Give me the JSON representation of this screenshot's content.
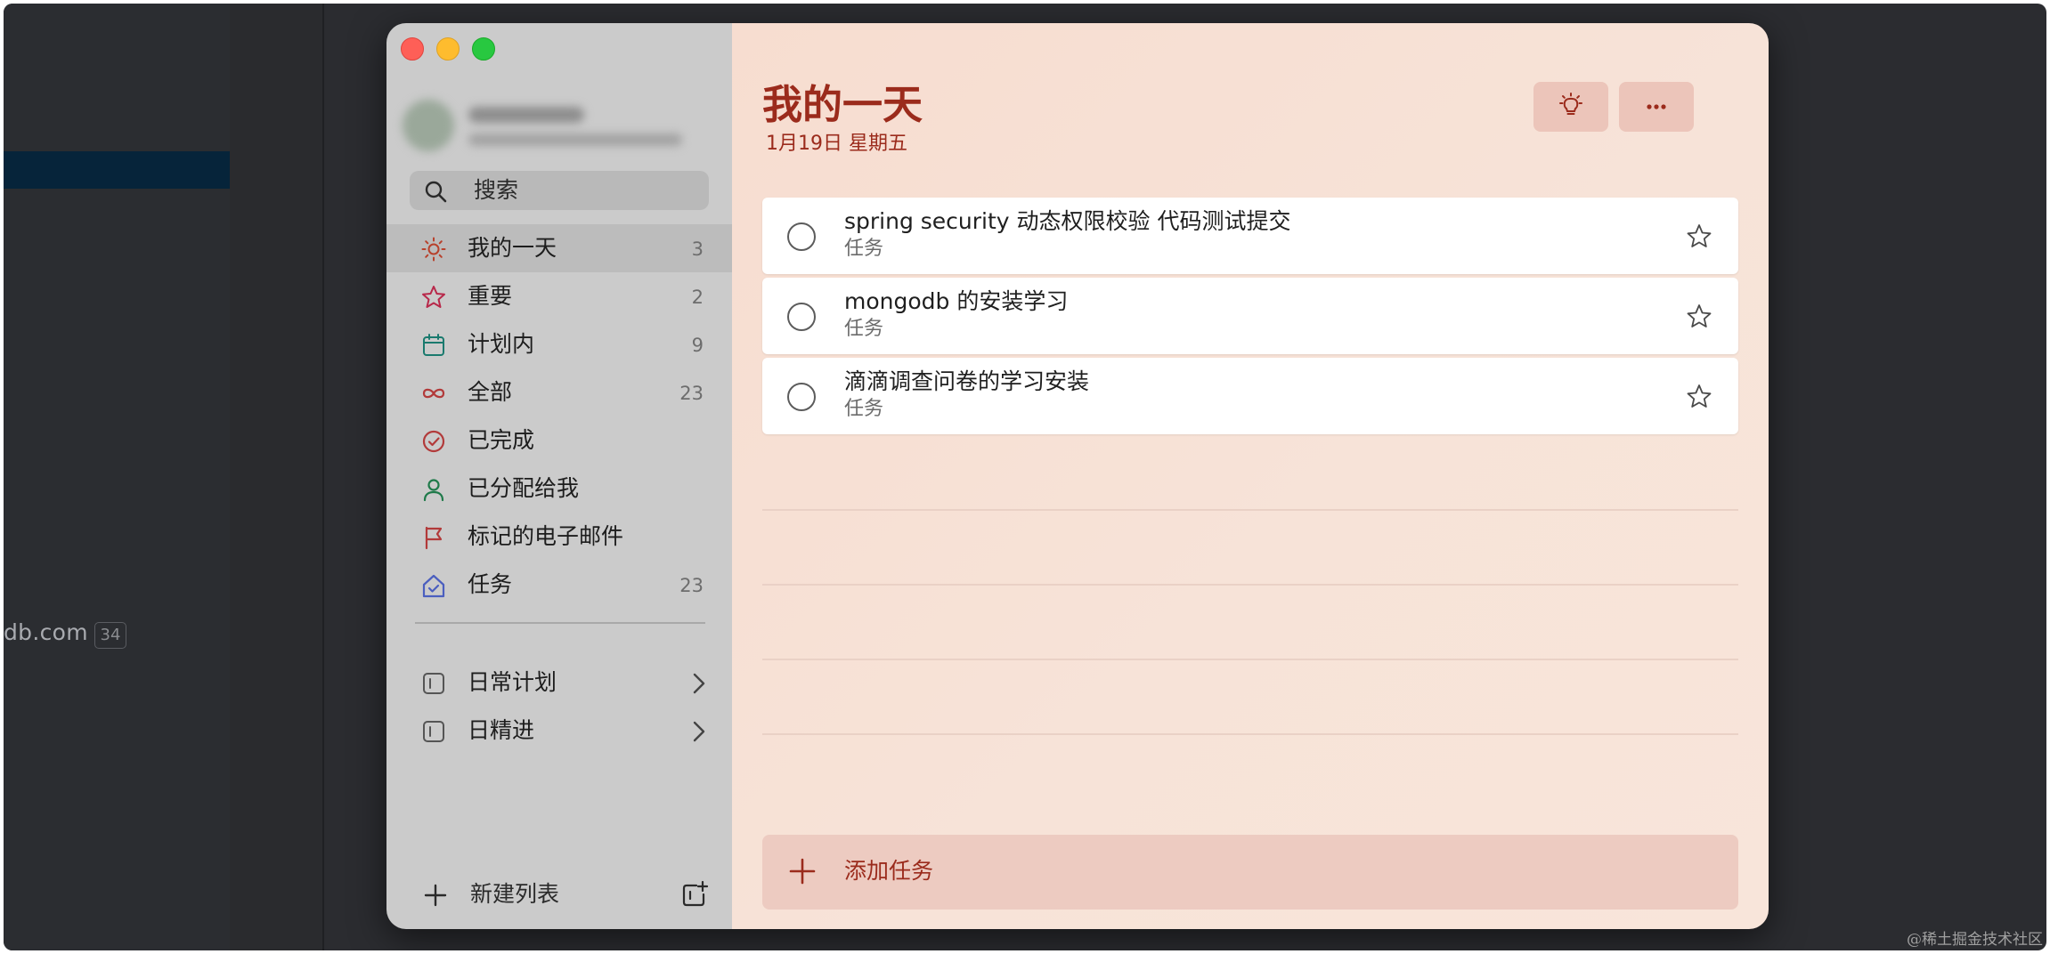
{
  "background": {
    "domain_fragment": "db.com",
    "count_badge": "34",
    "watermark": "@稀土掘金技术社区"
  },
  "sidebar": {
    "search_placeholder": "搜索",
    "nav": [
      {
        "label": "我的一天",
        "count": "3",
        "icon": "sun-icon",
        "color": "#b8412c",
        "active": true
      },
      {
        "label": "重要",
        "count": "2",
        "icon": "star-icon",
        "color": "#b8284a"
      },
      {
        "label": "计划内",
        "count": "9",
        "icon": "calendar-icon",
        "color": "#1a7a6e"
      },
      {
        "label": "全部",
        "count": "23",
        "icon": "infinity-icon",
        "color": "#b23a3a"
      },
      {
        "label": "已完成",
        "count": "",
        "icon": "check-circle-icon",
        "color": "#b23a3a"
      },
      {
        "label": "已分配给我",
        "count": "",
        "icon": "person-icon",
        "color": "#1f7a4a"
      },
      {
        "label": "标记的电子邮件",
        "count": "",
        "icon": "flag-icon",
        "color": "#b23a3a"
      },
      {
        "label": "任务",
        "count": "23",
        "icon": "house-icon",
        "color": "#4b5fbf"
      }
    ],
    "groups": [
      {
        "label": "日常计划",
        "icon": "group-folder-icon"
      },
      {
        "label": "日精进",
        "icon": "group-folder-icon"
      }
    ],
    "new_list_label": "新建列表"
  },
  "main": {
    "title": "我的一天",
    "date": "1月19日 星期五",
    "accent_color": "#9b2b1c",
    "tasks": [
      {
        "title": "spring security 动态权限校验 代码测试提交",
        "list": "任务",
        "completed": false,
        "important": false
      },
      {
        "title": "mongodb 的安装学习",
        "list": "任务",
        "completed": false,
        "important": false
      },
      {
        "title": "滴滴调查问卷的学习安装",
        "list": "任务",
        "completed": false,
        "important": false
      }
    ],
    "add_task_label": "添加任务"
  }
}
